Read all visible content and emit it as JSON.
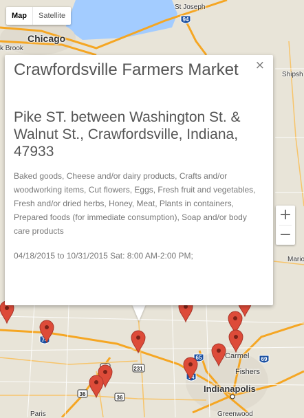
{
  "map": {
    "type_buttons": [
      "Map",
      "Satellite"
    ],
    "active_type": "Map",
    "zoom_in": "+",
    "zoom_out": "−",
    "labels": {
      "chicago": "Chicago",
      "st_joseph": "St Joseph",
      "brook": "k Brook",
      "shipsh": "Shipsh",
      "mario": "Mario",
      "carmel": "Carmel",
      "fishers": "Fishers",
      "indianapolis": "Indianapolis",
      "greenwood": "Greenwood",
      "paris": "Paris",
      "i94": "94",
      "i74": "74",
      "i65": "65",
      "i69": "69",
      "i465": "465",
      "r231": "231",
      "r41": "41",
      "r36a": "36",
      "r36b": "36"
    },
    "colors": {
      "marker": "#dd4b39",
      "highway": "#f5a623",
      "road": "#ffffff",
      "land": "#e8e4d8"
    },
    "marker_count": 11
  },
  "infowindow": {
    "title": "Crawfordsville Farmers Market",
    "address": "Pike ST. between Washington St. & Walnut St., Crawfordsville, Indiana, 47933",
    "products": "Baked goods, Cheese and/or dairy products, Crafts and/or woodworking items, Cut flowers, Eggs, Fresh fruit and vegetables, Fresh and/or dried herbs, Honey, Meat, Plants in containers, Prepared foods (for immediate consumption), Soap and/or body care products",
    "schedule": "04/18/2015 to 10/31/2015 Sat: 8:00 AM-2:00 PM;",
    "close_icon": "×"
  }
}
